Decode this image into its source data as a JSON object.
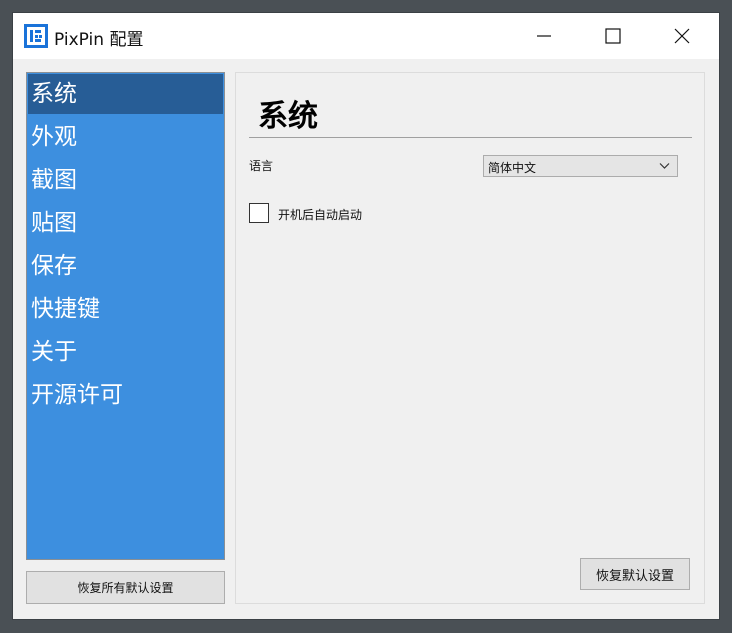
{
  "window": {
    "title": "PixPin 配置",
    "app_icon": "pixpin-logo-icon",
    "controls": [
      "minimize-icon",
      "maximize-icon",
      "close-icon"
    ]
  },
  "sidebar": {
    "items": [
      {
        "label": "系统",
        "active": true
      },
      {
        "label": "外观",
        "active": false
      },
      {
        "label": "截图",
        "active": false
      },
      {
        "label": "贴图",
        "active": false
      },
      {
        "label": "保存",
        "active": false
      },
      {
        "label": "快捷键",
        "active": false
      },
      {
        "label": "关于",
        "active": false
      },
      {
        "label": "开源许可",
        "active": false
      }
    ],
    "reset_all_label": "恢复所有默认设置"
  },
  "panel": {
    "title": "系统",
    "language": {
      "label": "语言",
      "value": "简体中文"
    },
    "autostart": {
      "label": "开机后自动启动",
      "checked": false
    },
    "reset_label": "恢复默认设置"
  },
  "colors": {
    "sidebar_bg": "#3d8fdf",
    "sidebar_active": "#275d96",
    "background": "#f0f0f0",
    "titlebar": "#ffffff",
    "app_icon_blue": "#1a73d9"
  }
}
